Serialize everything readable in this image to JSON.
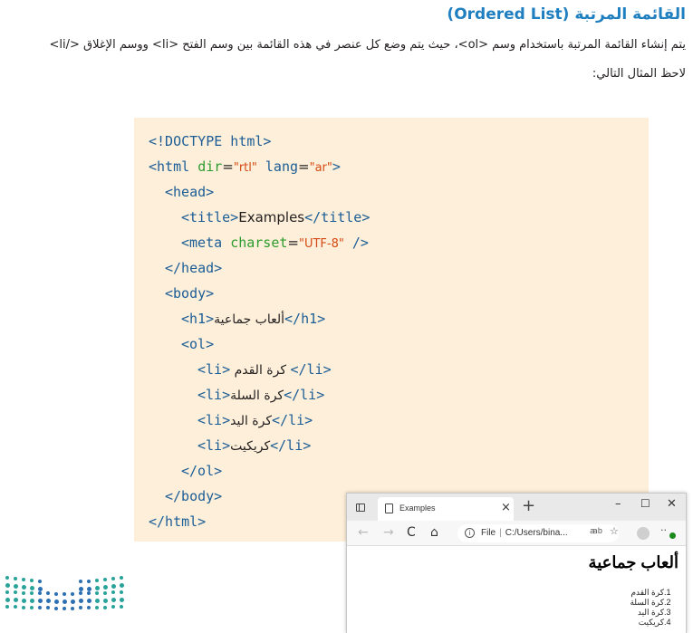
{
  "document": {
    "heading": "القائمة المرتبة (Ordered List)",
    "paragraph_line1": "يتم إنشاء القائمة المرتبة باستخدام وسم <ol>، حيث يتم وضع كل عنصر في هذه القائمة بين وسم الفتح <li> ووسم الإغلاق </li>",
    "paragraph_line2": "لاحظ المثال التالي:"
  },
  "code": {
    "doctype": "<!DOCTYPE html>",
    "html_open": "<html ",
    "html_attr1": "dir",
    "html_val1": "\"rtl\"",
    "html_attr2": " lang",
    "html_val2": "\"ar\"",
    "html_close_bracket": ">",
    "head_open": "<head>",
    "title_open": "<title>",
    "title_text": "Examples",
    "title_close": "</title>",
    "meta_open": "<meta ",
    "meta_attr": "charset",
    "meta_val": "\"UTF-8\"",
    "meta_close": " />",
    "head_close": "</head>",
    "body_open": "<body>",
    "h1_open": "<h1>",
    "h1_text": "ألعاب جماعية",
    "h1_close": "</h1>",
    "ol_open": "<ol>",
    "li_open": "<li>",
    "li_close": "</li>",
    "li_items": [
      " كرة القدم ",
      "كرة السلة",
      "كرة اليد",
      "كريكيت"
    ],
    "ol_close": "</ol>",
    "body_close": "</body>",
    "html_end": "</html>"
  },
  "browser": {
    "tab_title": "Examples",
    "tab_close": "×",
    "new_tab": "+",
    "minimize": "–",
    "maximize": "☐",
    "close": "✕",
    "back": "←",
    "forward": "→",
    "refresh": "C",
    "home": "⌂",
    "info": "i",
    "url_label": "File",
    "url_separator": "|",
    "url_path": "C:/Users/bina...",
    "read_aloud": "ꜳb",
    "favorites": "☆",
    "more": "··",
    "page_h1": "ألعاب جماعية",
    "page_list": [
      {
        "num": "1.",
        "text": "كرة القدم"
      },
      {
        "num": "2.",
        "text": "كرة السلة"
      },
      {
        "num": "3.",
        "text": "كرة اليد"
      },
      {
        "num": "4.",
        "text": "كريكيت"
      }
    ]
  },
  "colors": {
    "heading": "#1f7fc0",
    "code_background": "#fdefd9",
    "code_tag": "#1c5d96",
    "code_attribute": "#2e9c2e",
    "code_value": "#d44a14",
    "logo_teal": "#29a399",
    "logo_blue": "#2c6fb2"
  }
}
